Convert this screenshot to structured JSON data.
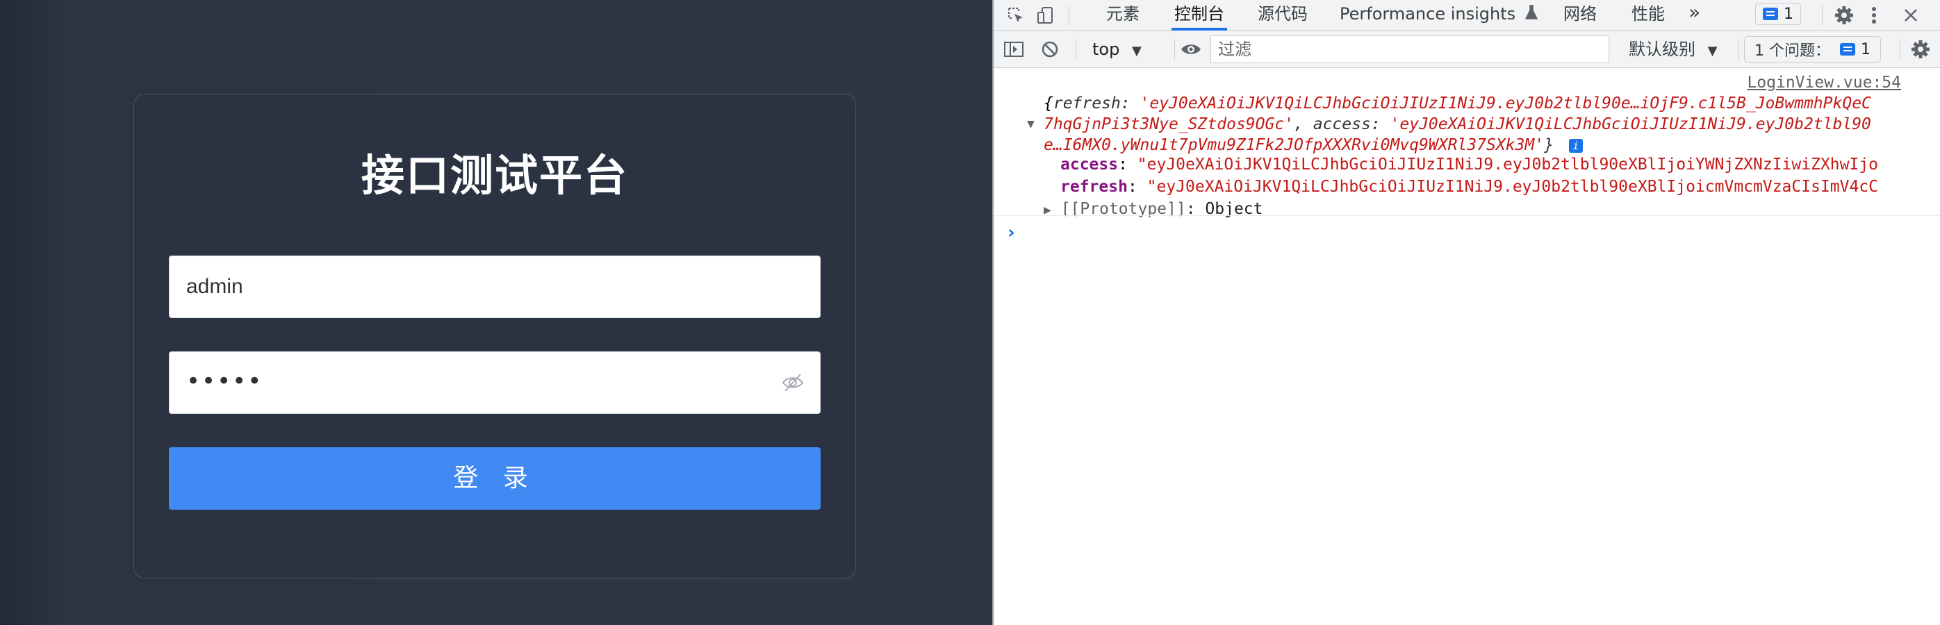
{
  "app": {
    "title": "接口测试平台",
    "username_value": "admin",
    "password_mask": "•••••",
    "login_label": "登 录"
  },
  "devtools": {
    "tabs": [
      {
        "label": "元素",
        "active": false
      },
      {
        "label": "控制台",
        "active": true
      },
      {
        "label": "源代码",
        "active": false
      },
      {
        "label": "Performance insights",
        "active": false
      },
      {
        "label": "网络",
        "active": false
      },
      {
        "label": "性能",
        "active": false
      }
    ],
    "more_tabs": "»",
    "message_count": "1",
    "toolbar": {
      "context": "top",
      "filter_placeholder": "过滤",
      "levels": "默认级别",
      "issues_label": "1 个问题：",
      "issues_count": "1"
    },
    "console": {
      "source": "LoginView.vue:54",
      "summary": {
        "open": "{",
        "refresh_key": "refresh",
        "refresh_val_1": "'eyJ0eXAiOiJKV1QiLCJhbGciOiJIUzI1NiJ9.eyJ0b2tlbl90e…iOjF9.c1l5B_JoBwmmhPkQeC",
        "refresh_val_2": "7hqGjnPi3t3Nye_SZtdos9OGc'",
        "access_key": "access",
        "access_val_1": "'eyJ0eXAiOiJKV1QiLCJhbGciOiJIUzI1NiJ9.eyJ0b2tlbl90",
        "access_val_2": "e…I6MX0.yWnu1t7pVmu9Z1Fk2JOfpXXXRvi0Mvq9WXRl37SXk3M'",
        "close": "}"
      },
      "props": [
        {
          "key": "access",
          "value": "\"eyJ0eXAiOiJKV1QiLCJhbGciOiJIUzI1NiJ9.eyJ0b2tlbl90eXBlIjoiYWNjZXNzIiwiZXhwIjo"
        },
        {
          "key": "refresh",
          "value": "\"eyJ0eXAiOiJKV1QiLCJhbGciOiJIUzI1NiJ9.eyJ0b2tlbl90eXBlIjoicmVmcmVzaCIsImV4cC"
        }
      ],
      "prototype_label": "[[Prototype]]",
      "prototype_value": "Object",
      "prompt": "›"
    }
  },
  "colors": {
    "accent": "#1a73e8",
    "login_button": "#4189f3",
    "app_bg": "#2e3646",
    "string": "#c41a16",
    "prop_key": "#881280"
  }
}
